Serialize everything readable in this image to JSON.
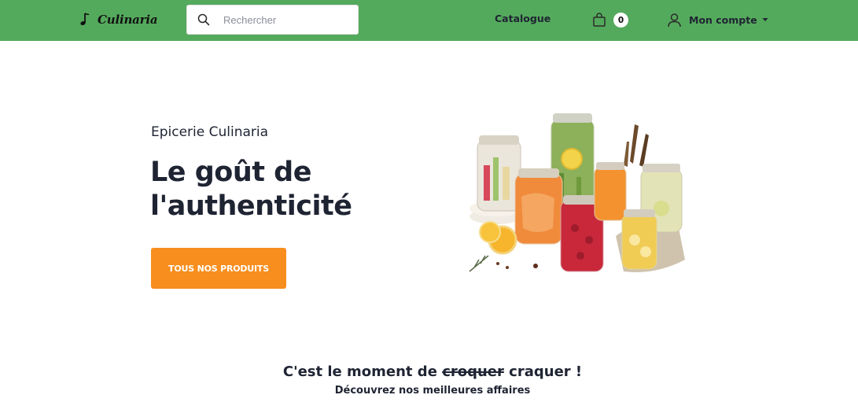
{
  "navbar": {
    "brand_name": "Culinaria",
    "brand_icon": "music-note-icon",
    "search": {
      "placeholder": "Rechercher",
      "value": ""
    },
    "catalogue_label": "Catalogue",
    "cart_count": "0",
    "account_label": "Mon compte",
    "accent_color": "#54aa5c"
  },
  "hero": {
    "kicker": "Epicerie Culinaria",
    "title": "Le goût de l'authenticité",
    "cta_label": "TOUS NOS PRODUITS",
    "cta_color": "#f78e1e",
    "image_subject": "pickled-vegetable-jars"
  },
  "promo": {
    "title_before": "C'est le moment de",
    "title_strike": "croquer",
    "title_after": "craquer !",
    "subtitle": "Découvrez nos meilleures affaires"
  }
}
